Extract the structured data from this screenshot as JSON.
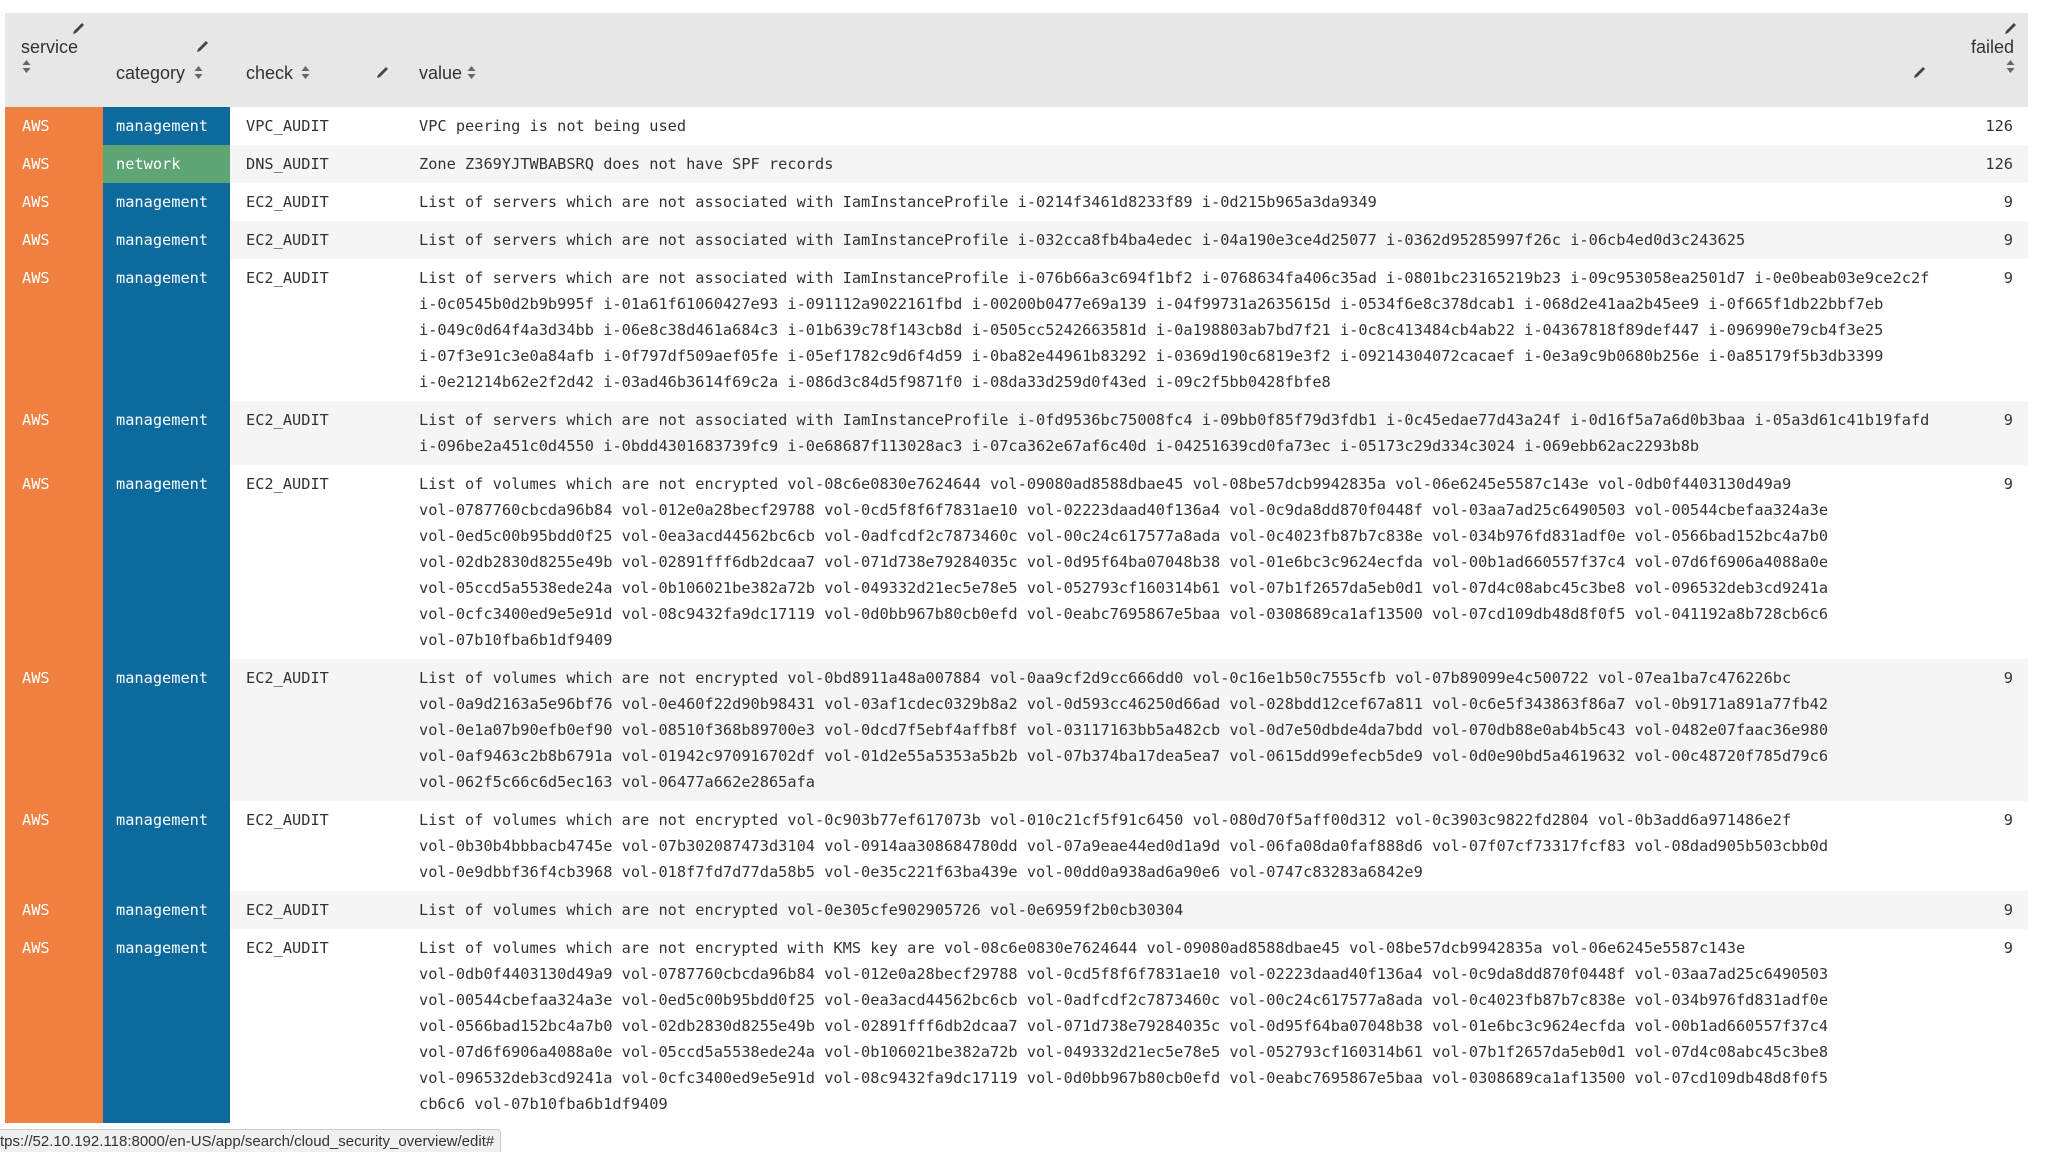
{
  "columns": {
    "service": "service",
    "category": "category",
    "check": "check",
    "value": "value",
    "failed": "failed"
  },
  "colors": {
    "service_cell": "#f08040",
    "category_management": "#0c6a9c",
    "category_network": "#5da574",
    "header_bg": "#e7e7e7"
  },
  "icons": {
    "edit": "pencil-icon",
    "sort": "sort-arrows-icon"
  },
  "rows": [
    {
      "service": "AWS",
      "category": "management",
      "check": "VPC_AUDIT",
      "value_lines": [
        "VPC peering is not being used"
      ],
      "failed": "126"
    },
    {
      "service": "AWS",
      "category": "network",
      "check": "DNS_AUDIT",
      "value_lines": [
        "Zone Z369YJTWBABSRQ does not have SPF records"
      ],
      "failed": "126"
    },
    {
      "service": "AWS",
      "category": "management",
      "check": "EC2_AUDIT",
      "value_lines": [
        "List of servers which are not associated with IamInstanceProfile i-0214f3461d8233f89 i-0d215b965a3da9349"
      ],
      "failed": "9"
    },
    {
      "service": "AWS",
      "category": "management",
      "check": "EC2_AUDIT",
      "value_lines": [
        "List of servers which are not associated with IamInstanceProfile i-032cca8fb4ba4edec i-04a190e3ce4d25077 i-0362d95285997f26c i-06cb4ed0d3c243625"
      ],
      "failed": "9"
    },
    {
      "service": "AWS",
      "category": "management",
      "check": "EC2_AUDIT",
      "value_lines": [
        "List of servers which are not associated with IamInstanceProfile i-076b66a3c694f1bf2 i-0768634fa406c35ad i-0801bc23165219b23 i-09c953058ea2501d7 i-0e0beab03e9ce2c2f",
        "i-0c0545b0d2b9b995f i-01a61f61060427e93 i-091112a9022161fbd i-00200b0477e69a139 i-04f99731a2635615d i-0534f6e8c378dcab1 i-068d2e41aa2b45ee9 i-0f665f1db22bbf7eb",
        "i-049c0d64f4a3d34bb i-06e8c38d461a684c3 i-01b639c78f143cb8d i-0505cc5242663581d i-0a198803ab7bd7f21 i-0c8c413484cb4ab22 i-04367818f89def447 i-096990e79cb4f3e25",
        "i-07f3e91c3e0a84afb i-0f797df509aef05fe i-05ef1782c9d6f4d59 i-0ba82e44961b83292 i-0369d190c6819e3f2 i-09214304072cacaef i-0e3a9c9b0680b256e i-0a85179f5b3db3399",
        "i-0e21214b62e2f2d42 i-03ad46b3614f69c2a i-086d3c84d5f9871f0 i-08da33d259d0f43ed i-09c2f5bb0428fbfe8"
      ],
      "failed": "9"
    },
    {
      "service": "AWS",
      "category": "management",
      "check": "EC2_AUDIT",
      "value_lines": [
        "List of servers which are not associated with IamInstanceProfile i-0fd9536bc75008fc4 i-09bb0f85f79d3fdb1 i-0c45edae77d43a24f i-0d16f5a7a6d0b3baa i-05a3d61c41b19fafd",
        "i-096be2a451c0d4550 i-0bdd4301683739fc9 i-0e68687f113028ac3 i-07ca362e67af6c40d i-04251639cd0fa73ec i-05173c29d334c3024 i-069ebb62ac2293b8b"
      ],
      "failed": "9"
    },
    {
      "service": "AWS",
      "category": "management",
      "check": "EC2_AUDIT",
      "value_lines": [
        "List of volumes which are not encrypted vol-08c6e0830e7624644 vol-09080ad8588dbae45 vol-08be57dcb9942835a vol-06e6245e5587c143e vol-0db0f4403130d49a9",
        "vol-0787760cbcda96b84 vol-012e0a28becf29788 vol-0cd5f8f6f7831ae10 vol-02223daad40f136a4 vol-0c9da8dd870f0448f vol-03aa7ad25c6490503 vol-00544cbefaa324a3e",
        "vol-0ed5c00b95bdd0f25 vol-0ea3acd44562bc6cb vol-0adfcdf2c7873460c vol-00c24c617577a8ada vol-0c4023fb87b7c838e vol-034b976fd831adf0e vol-0566bad152bc4a7b0",
        "vol-02db2830d8255e49b vol-02891fff6db2dcaa7 vol-071d738e79284035c vol-0d95f64ba07048b38 vol-01e6bc3c9624ecfda vol-00b1ad660557f37c4 vol-07d6f6906a4088a0e",
        "vol-05ccd5a5538ede24a vol-0b106021be382a72b vol-049332d21ec5e78e5 vol-052793cf160314b61 vol-07b1f2657da5eb0d1 vol-07d4c08abc45c3be8 vol-096532deb3cd9241a",
        "vol-0cfc3400ed9e5e91d vol-08c9432fa9dc17119 vol-0d0bb967b80cb0efd vol-0eabc7695867e5baa vol-0308689ca1af13500 vol-07cd109db48d8f0f5 vol-041192a8b728cb6c6",
        "vol-07b10fba6b1df9409"
      ],
      "failed": "9"
    },
    {
      "service": "AWS",
      "category": "management",
      "check": "EC2_AUDIT",
      "value_lines": [
        "List of volumes which are not encrypted vol-0bd8911a48a007884 vol-0aa9cf2d9cc666dd0 vol-0c16e1b50c7555cfb vol-07b89099e4c500722 vol-07ea1ba7c476226bc",
        "vol-0a9d2163a5e96bf76 vol-0e460f22d90b98431 vol-03af1cdec0329b8a2 vol-0d593cc46250d66ad vol-028bdd12cef67a811 vol-0c6e5f343863f86a7 vol-0b9171a891a77fb42",
        "vol-0e1a07b90efb0ef90 vol-08510f368b89700e3 vol-0dcd7f5ebf4affb8f vol-03117163bb5a482cb vol-0d7e50dbde4da7bdd vol-070db88e0ab4b5c43 vol-0482e07faac36e980",
        "vol-0af9463c2b8b6791a vol-01942c970916702df vol-01d2e55a5353a5b2b vol-07b374ba17dea5ea7 vol-0615dd99efecb5de9 vol-0d0e90bd5a4619632 vol-00c48720f785d79c6",
        "vol-062f5c66c6d5ec163 vol-06477a662e2865afa"
      ],
      "failed": "9"
    },
    {
      "service": "AWS",
      "category": "management",
      "check": "EC2_AUDIT",
      "value_lines": [
        "List of volumes which are not encrypted vol-0c903b77ef617073b vol-010c21cf5f91c6450 vol-080d70f5aff00d312 vol-0c3903c9822fd2804 vol-0b3add6a971486e2f",
        "vol-0b30b4bbbacb4745e vol-07b302087473d3104 vol-0914aa308684780dd vol-07a9eae44ed0d1a9d vol-06fa08da0faf888d6 vol-07f07cf73317fcf83 vol-08dad905b503cbb0d",
        "vol-0e9dbbf36f4cb3968 vol-018f7fd7d77da58b5 vol-0e35c221f63ba439e vol-00dd0a938ad6a90e6 vol-0747c83283a6842e9"
      ],
      "failed": "9"
    },
    {
      "service": "AWS",
      "category": "management",
      "check": "EC2_AUDIT",
      "value_lines": [
        "List of volumes which are not encrypted vol-0e305cfe902905726 vol-0e6959f2b0cb30304"
      ],
      "failed": "9"
    },
    {
      "service": "AWS",
      "category": "management",
      "check": "EC2_AUDIT",
      "value_lines": [
        "List of volumes which are not encrypted with KMS key are vol-08c6e0830e7624644 vol-09080ad8588dbae45 vol-08be57dcb9942835a vol-06e6245e5587c143e",
        "vol-0db0f4403130d49a9 vol-0787760cbcda96b84 vol-012e0a28becf29788 vol-0cd5f8f6f7831ae10 vol-02223daad40f136a4 vol-0c9da8dd870f0448f vol-03aa7ad25c6490503",
        "vol-00544cbefaa324a3e vol-0ed5c00b95bdd0f25 vol-0ea3acd44562bc6cb vol-0adfcdf2c7873460c vol-00c24c617577a8ada vol-0c4023fb87b7c838e vol-034b976fd831adf0e",
        "vol-0566bad152bc4a7b0 vol-02db2830d8255e49b vol-02891fff6db2dcaa7 vol-071d738e79284035c vol-0d95f64ba07048b38 vol-01e6bc3c9624ecfda vol-00b1ad660557f37c4",
        "vol-07d6f6906a4088a0e vol-05ccd5a5538ede24a vol-0b106021be382a72b vol-049332d21ec5e78e5 vol-052793cf160314b61 vol-07b1f2657da5eb0d1 vol-07d4c08abc45c3be8",
        "vol-096532deb3cd9241a vol-0cfc3400ed9e5e91d vol-08c9432fa9dc17119 vol-0d0bb967b80cb0efd vol-0eabc7695867e5baa vol-0308689ca1af13500 vol-07cd109db48d8f0f5",
        "cb6c6 vol-07b10fba6b1df9409"
      ],
      "failed": "9"
    }
  ],
  "status_bar": {
    "url": "tps://52.10.192.118:8000/en-US/app/search/cloud_security_overview/edit#"
  }
}
